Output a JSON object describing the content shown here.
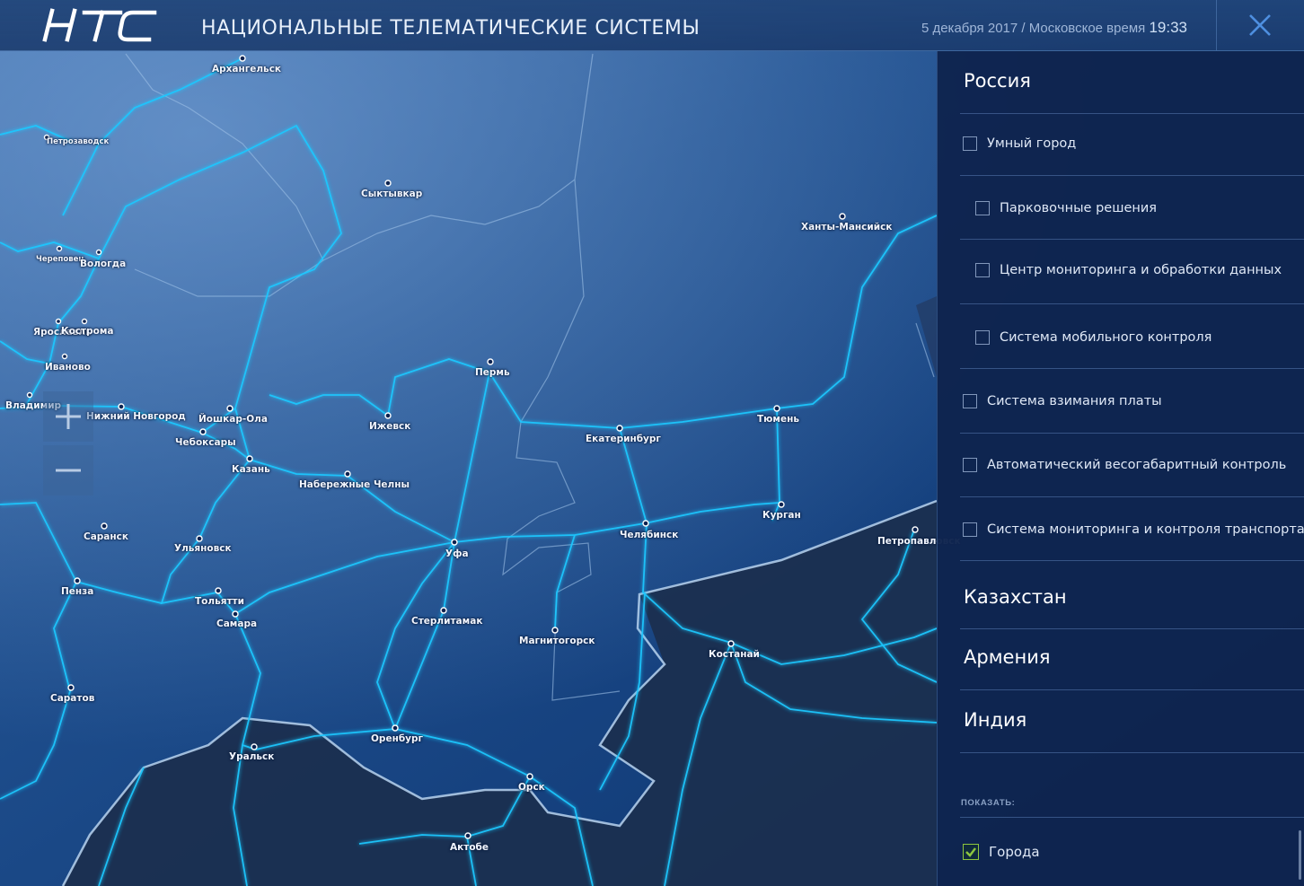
{
  "header": {
    "logo_text": "НТС",
    "title": "НАЦИОНАЛЬНЫЕ ТЕЛЕМАТИЧЕСКИЕ СИСТЕМЫ",
    "date_text": "5 декабря 2017 / Московское время",
    "time": "19:33",
    "close_icon": "close-icon"
  },
  "zoom": {
    "in_icon": "plus-icon",
    "out_icon": "minus-icon"
  },
  "map": {
    "cities": [
      "Архангельск",
      "Петрозаводск",
      "Сыктывкар",
      "Череповец",
      "Вологда",
      "Ханты-Мансийск",
      "Ярославль",
      "Кострома",
      "Иваново",
      "Пермь",
      "Владимир",
      "Нижний Новгород",
      "Йошкар-Ола",
      "Ижевск",
      "Чебоксары",
      "Екатеринбург",
      "Тюмень",
      "Казань",
      "Набережные Челны",
      "Курган",
      "Саранск",
      "Ульяновск",
      "Челябинск",
      "Уфа",
      "Петропавловск",
      "Пенза",
      "Тольятти",
      "Самара",
      "Стерлитамак",
      "Магнитогорск",
      "Костанай",
      "Саратов",
      "Оренбург",
      "Уральск",
      "Орск",
      "Актобе"
    ]
  },
  "panel": {
    "regions": {
      "russia": "Россия",
      "kazakhstan": "Казахстан",
      "armenia": "Армения",
      "india": "Индия"
    },
    "options": [
      {
        "label": "Умный город",
        "checked": false
      },
      {
        "label": "Парковочные решения",
        "checked": false
      },
      {
        "label": "Центр мониторинга и обработки данных",
        "checked": false
      },
      {
        "label": "Система мобильного контроля",
        "checked": false
      },
      {
        "label": "Система взимания платы",
        "checked": false
      },
      {
        "label": "Автоматический весогабаритный контроль",
        "checked": false
      },
      {
        "label": "Система мониторинга и контроля транспорта",
        "checked": false
      }
    ],
    "show_label": "ПОКАЗАТЬ:",
    "show_options": [
      {
        "label": "Города",
        "checked": true
      }
    ]
  },
  "colors": {
    "header_bg": "#1f4478",
    "panel_bg": "#0e244e",
    "road": "#1ec8ff",
    "border": "#b8d4f0",
    "checkbox_checked": "#8dc63f"
  }
}
